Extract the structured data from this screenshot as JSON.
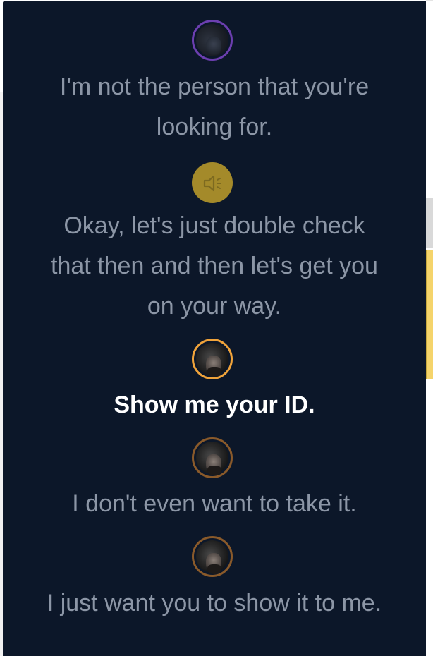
{
  "transcript": [
    {
      "speaker_avatar": "character-avatar",
      "text": "I'm not the person that you're looking for.",
      "state": "past"
    },
    {
      "speaker_avatar": "speaker-icon",
      "text": "Okay, let's just double check that then and then let's get you on your way.",
      "state": "past"
    },
    {
      "speaker_avatar": "character-avatar",
      "text": "Show me your ID.",
      "state": "active"
    },
    {
      "speaker_avatar": "character-avatar",
      "text": "I don't even want to take it.",
      "state": "upcoming"
    },
    {
      "speaker_avatar": "character-avatar",
      "text": "I just want you to show it to me.",
      "state": "upcoming"
    }
  ],
  "colors": {
    "panel_background": "#0c1729",
    "text_inactive": "#8c96a6",
    "text_active": "#ffffff",
    "ring_purple": "#6c3fb0",
    "ring_orange": "#f0a33a",
    "ring_brown": "#8a5a2a",
    "speaker_fill": "#a48a2a"
  }
}
